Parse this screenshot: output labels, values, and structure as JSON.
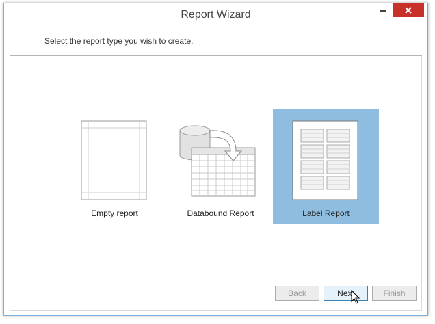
{
  "window": {
    "title": "Report Wizard"
  },
  "instruction": "Select the report type you wish to create.",
  "report_types": [
    {
      "label": "Empty report",
      "icon": "empty-report-icon",
      "selected": false
    },
    {
      "label": "Databound Report",
      "icon": "databound-report-icon",
      "selected": false
    },
    {
      "label": "Label Report",
      "icon": "label-report-icon",
      "selected": true
    }
  ],
  "buttons": {
    "back": "Back",
    "next": "Next",
    "finish": "Finish"
  },
  "colors": {
    "selection": "#8fbde0",
    "close": "#c7312a",
    "border": "#7aaed9"
  }
}
